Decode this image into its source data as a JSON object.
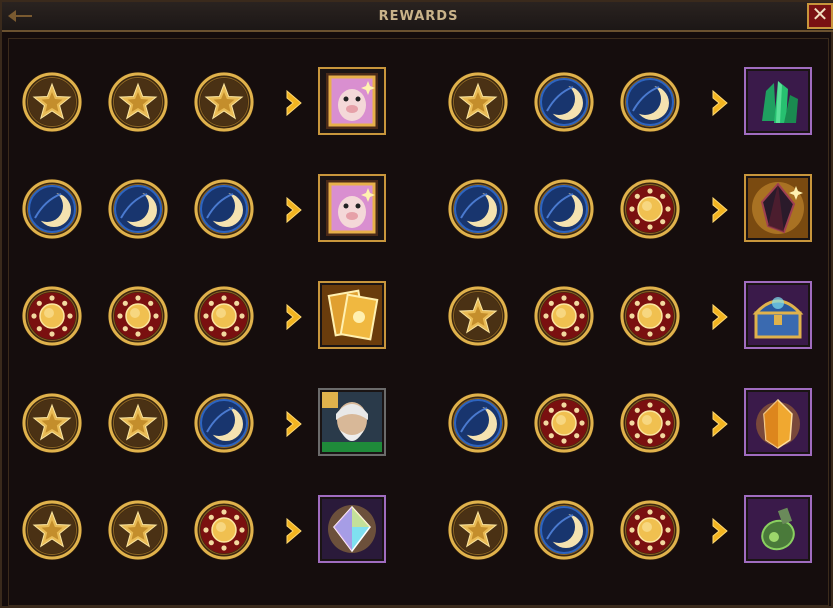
{
  "window": {
    "title": "REWARDS",
    "close_icon": "close-x-icon"
  },
  "columns": [
    {
      "rows": [
        {
          "tokens": [
            "star",
            "star",
            "star"
          ],
          "arrow_icon": "chevron-right-icon",
          "reward": {
            "name": "pig-card-reward-icon",
            "frame": "gold"
          }
        },
        {
          "tokens": [
            "moon",
            "moon",
            "moon"
          ],
          "arrow_icon": "chevron-right-icon",
          "reward": {
            "name": "pig-card-reward-icon",
            "frame": "gold"
          }
        },
        {
          "tokens": [
            "sun",
            "sun",
            "sun"
          ],
          "arrow_icon": "chevron-right-icon",
          "reward": {
            "name": "golden-cards-reward-icon",
            "frame": "gold"
          }
        },
        {
          "tokens": [
            "star",
            "star",
            "moon"
          ],
          "arrow_icon": "chevron-right-icon",
          "reward": {
            "name": "hero-portrait-reward-icon",
            "frame": "gray"
          }
        },
        {
          "tokens": [
            "star",
            "star",
            "sun"
          ],
          "arrow_icon": "chevron-right-icon",
          "reward": {
            "name": "rainbow-gem-reward-icon",
            "frame": "purple"
          }
        }
      ]
    },
    {
      "rows": [
        {
          "tokens": [
            "star",
            "moon",
            "moon"
          ],
          "arrow_icon": "chevron-right-icon",
          "reward": {
            "name": "emerald-crystal-reward-icon",
            "frame": "purple"
          }
        },
        {
          "tokens": [
            "moon",
            "moon",
            "sun"
          ],
          "arrow_icon": "chevron-right-icon",
          "reward": {
            "name": "dark-crystal-reward-icon",
            "frame": "gold"
          }
        },
        {
          "tokens": [
            "star",
            "sun",
            "sun"
          ],
          "arrow_icon": "chevron-right-icon",
          "reward": {
            "name": "treasure-chest-reward-icon",
            "frame": "purple"
          }
        },
        {
          "tokens": [
            "moon",
            "sun",
            "sun"
          ],
          "arrow_icon": "chevron-right-icon",
          "reward": {
            "name": "amber-crystal-reward-icon",
            "frame": "purple"
          }
        },
        {
          "tokens": [
            "star",
            "moon",
            "sun"
          ],
          "arrow_icon": "chevron-right-icon",
          "reward": {
            "name": "potion-flask-reward-icon",
            "frame": "purple"
          }
        }
      ]
    }
  ],
  "colors": {
    "gold": "#d9a640",
    "moon_blue": "#1f4f9e",
    "sun_red": "#8e1414",
    "accent_border": "#c8963c"
  }
}
